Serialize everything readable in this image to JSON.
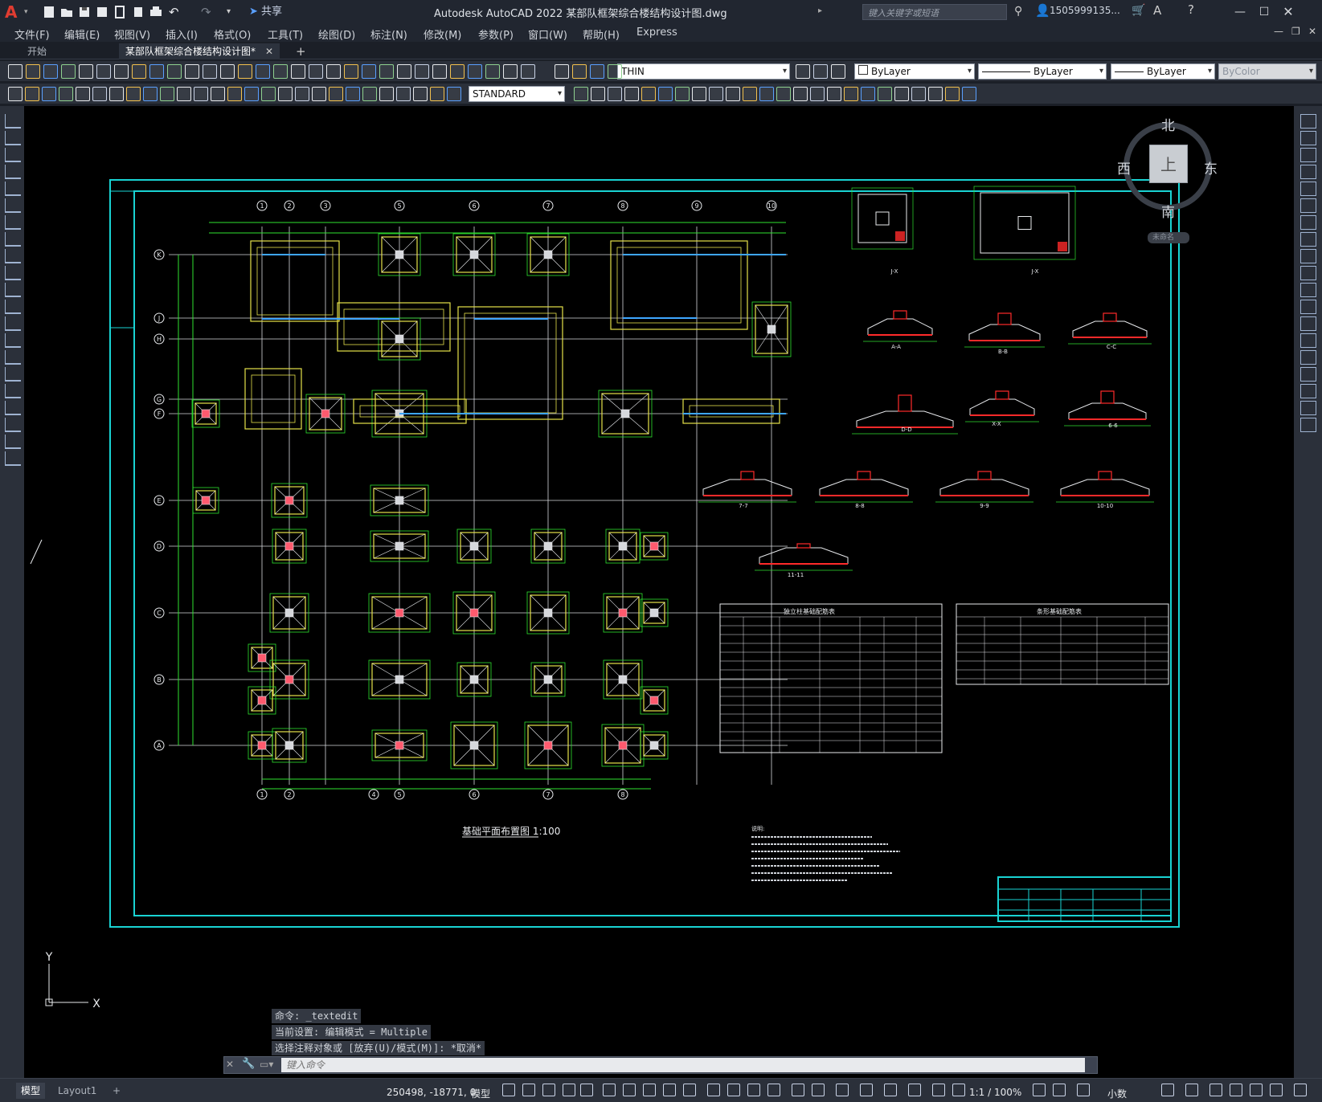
{
  "app": {
    "logo": "A",
    "title": "Autodesk AutoCAD 2022    某部队框架综合楼结构设计图.dwg",
    "share": "共享",
    "search_placeholder": "键入关键字或短语",
    "user": "1505999135...",
    "accent_color": "#e03c31"
  },
  "menu": [
    "文件(F)",
    "编辑(E)",
    "视图(V)",
    "插入(I)",
    "格式(O)",
    "工具(T)",
    "绘图(D)",
    "标注(N)",
    "修改(M)",
    "参数(P)",
    "窗口(W)",
    "帮助(H)",
    "Express"
  ],
  "tabs": {
    "start": "开始",
    "active": "某部队框架综合楼结构设计图*",
    "add": "+"
  },
  "toolbar": {
    "layer": "THIN",
    "color": "ByLayer",
    "linetype": "ByLayer",
    "lineweight": "ByLayer",
    "plotstyle": "ByColor",
    "textstyle": "STANDARD"
  },
  "viewcube": {
    "north": "北",
    "south": "南",
    "east": "东",
    "west": "西",
    "face": "上",
    "ucs": "未命名"
  },
  "drawing": {
    "axis_top": [
      "1",
      "2",
      "3",
      "5",
      "6",
      "7",
      "8",
      "9",
      "10"
    ],
    "axis_bottom": [
      "1",
      "2",
      "4",
      "5",
      "6",
      "7",
      "8"
    ],
    "axis_rows": [
      "K",
      "J",
      "H",
      "G",
      "F",
      "E",
      "D",
      "C",
      "B",
      "A"
    ],
    "plan_title": "基础平面布置图  1:100",
    "section_labels": [
      "J-X",
      "J-X",
      "A-A",
      "B-B",
      "C-C",
      "D-D",
      "X-X",
      "6-6",
      "7-7",
      "8-8",
      "9-9",
      "10-10",
      "11-11"
    ],
    "table1_title": "独立柱基础配筋表",
    "table2_title": "条形基础配筋表",
    "notes_title": "说明:",
    "ucs_y": "Y",
    "ucs_x": "X"
  },
  "command": {
    "history": [
      "命令: _textedit",
      "当前设置: 编辑模式 = Multiple",
      "选择注释对象或 [放弃(U)/模式(M)]: *取消*"
    ],
    "placeholder": "键入命令"
  },
  "status": {
    "model_tab": "模型",
    "layout_tab": "Layout1",
    "coords": "250498, -18771, 0",
    "model": "模型",
    "scale": "1:1 / 100%",
    "units": "小数"
  }
}
